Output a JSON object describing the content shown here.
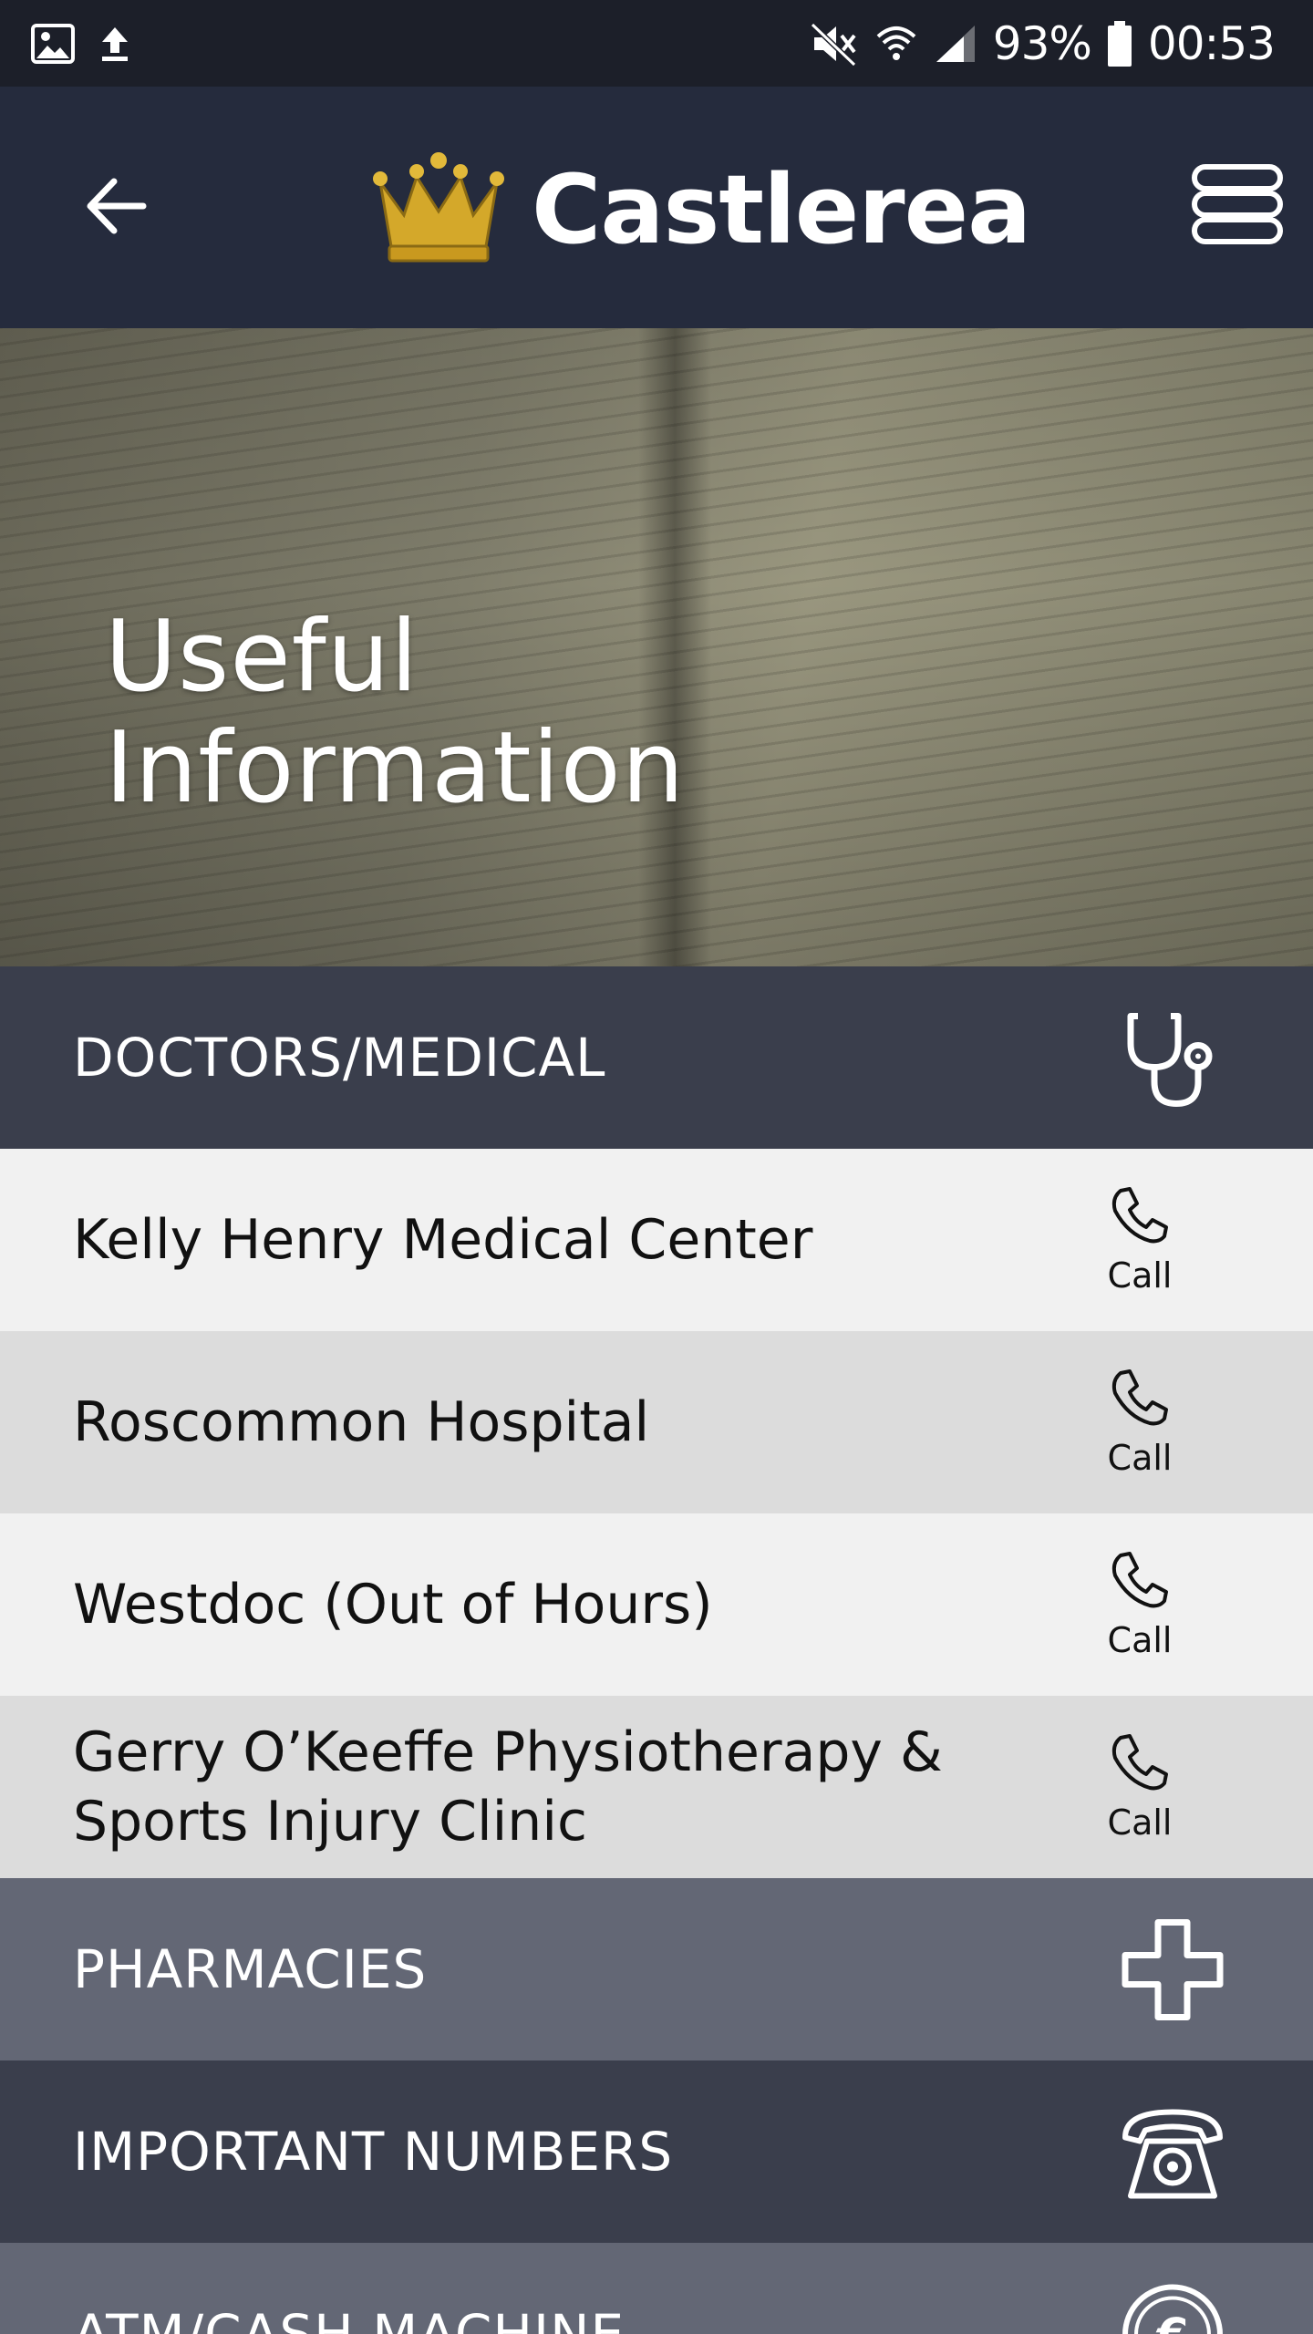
{
  "status_bar": {
    "battery": "93%",
    "time": "00:53"
  },
  "header": {
    "brand": "Castlerea",
    "logo": "crown-icon",
    "back_icon": "arrow-left-icon",
    "menu_icon": "menu-stack-icon",
    "colors": {
      "bar": "#252b3d",
      "crown": "#d4a82a"
    }
  },
  "hero": {
    "title_line1": "Useful",
    "title_line2": "Information"
  },
  "list": {
    "categories": {
      "medical": {
        "label": "DOCTORS/MEDICAL",
        "icon": "stethoscope-icon"
      },
      "pharmacies": {
        "label": "PHARMACIES",
        "icon": "medical-cross-icon"
      },
      "important": {
        "label": "IMPORTANT NUMBERS",
        "icon": "telephone-icon"
      },
      "atm": {
        "label": "ATM/CASH MACHINE",
        "icon": "euro-icon"
      }
    },
    "items": [
      {
        "name": "Kelly Henry Medical Center",
        "action": "Call"
      },
      {
        "name": "Roscommon Hospital",
        "action": "Call"
      },
      {
        "name": "Westdoc (Out of Hours)",
        "action": "Call"
      },
      {
        "name": "Gerry O’Keeffe Physiotherapy & Sports Injury Clinic",
        "action": "Call"
      }
    ]
  }
}
